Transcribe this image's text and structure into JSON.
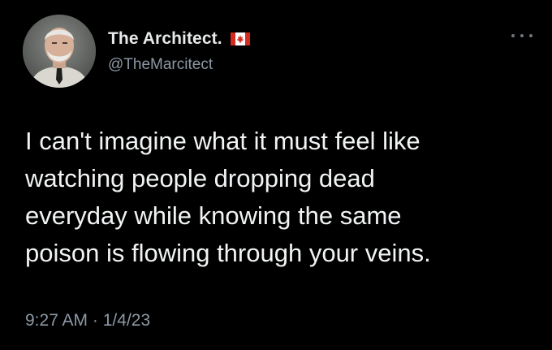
{
  "author": {
    "display_name": "The Architect.",
    "handle": "@TheMarcitect",
    "flag_icon": "canada-flag-icon",
    "avatar_icon": "profile-photo"
  },
  "tweet": {
    "text": "I can't imagine what it must feel like\nwatching people dropping dead\neveryday while knowing the same\npoison is flowing through your veins.",
    "time": "9:27 AM",
    "separator": "·",
    "date": "1/4/23"
  },
  "menu": {
    "icon": "more-options-icon"
  },
  "colors": {
    "background": "#000000",
    "primary_text": "#e7e9ea",
    "secondary_text": "#8b98a5",
    "flag_red": "#d52b1e"
  }
}
